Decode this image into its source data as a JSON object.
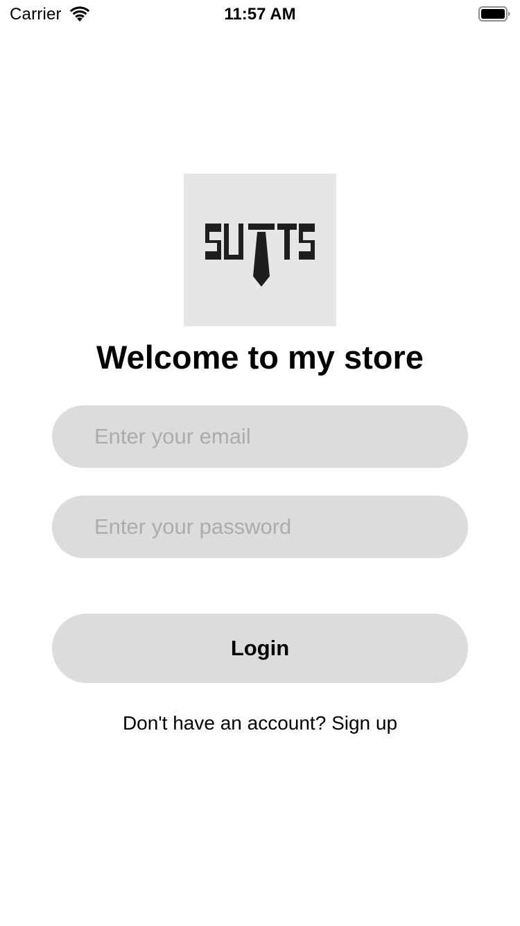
{
  "status_bar": {
    "carrier": "Carrier",
    "time": "11:57 AM",
    "wifi_icon": "wifi-icon",
    "battery_icon": "battery-icon"
  },
  "logo": {
    "brand_text": "SUITS",
    "icon": "tie-icon",
    "background_color": "#e6e6e6"
  },
  "title": "Welcome to my store",
  "form": {
    "email": {
      "value": "",
      "placeholder": "Enter your email"
    },
    "password": {
      "value": "",
      "placeholder": "Enter your password"
    },
    "login_label": "Login",
    "field_color": "#dcdcdc",
    "placeholder_color": "#acacac"
  },
  "signup_prompt": "Don't have an account? Sign up"
}
